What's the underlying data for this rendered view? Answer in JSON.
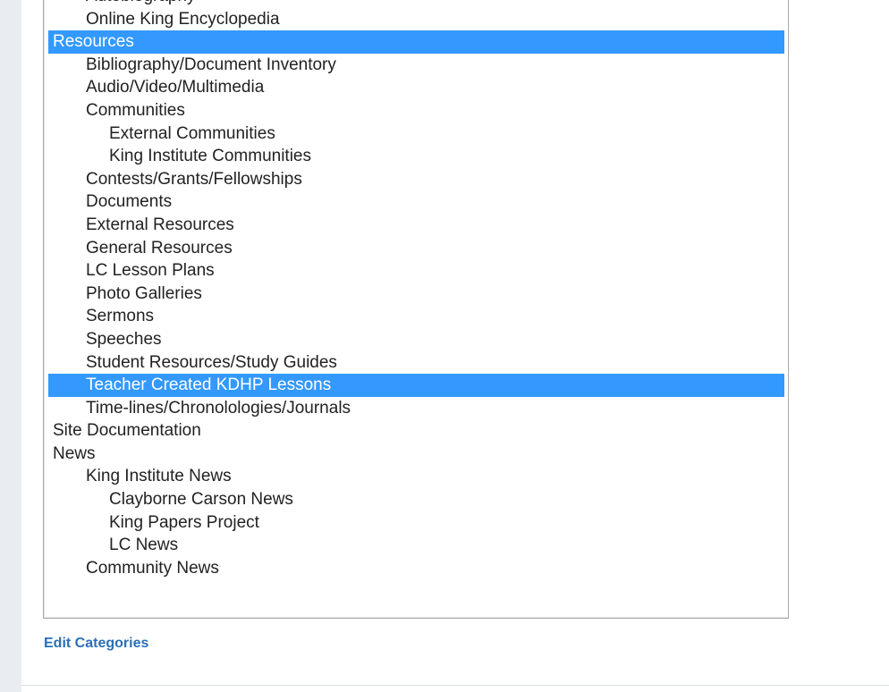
{
  "category_list": {
    "options": [
      {
        "label": "Autobiography",
        "level": 1,
        "selected": false
      },
      {
        "label": "Online King Encyclopedia",
        "level": 1,
        "selected": false
      },
      {
        "label": "Resources",
        "level": 0,
        "selected": true
      },
      {
        "label": "Bibliography/Document Inventory",
        "level": 1,
        "selected": false
      },
      {
        "label": "Audio/Video/Multimedia",
        "level": 1,
        "selected": false
      },
      {
        "label": "Communities",
        "level": 1,
        "selected": false
      },
      {
        "label": "External Communities",
        "level": 2,
        "selected": false
      },
      {
        "label": "King Institute Communities",
        "level": 2,
        "selected": false
      },
      {
        "label": "Contests/Grants/Fellowships",
        "level": 1,
        "selected": false
      },
      {
        "label": "Documents",
        "level": 1,
        "selected": false
      },
      {
        "label": "External Resources",
        "level": 1,
        "selected": false
      },
      {
        "label": "General Resources",
        "level": 1,
        "selected": false
      },
      {
        "label": "LC Lesson Plans",
        "level": 1,
        "selected": false
      },
      {
        "label": "Photo Galleries",
        "level": 1,
        "selected": false
      },
      {
        "label": "Sermons",
        "level": 1,
        "selected": false
      },
      {
        "label": "Speeches",
        "level": 1,
        "selected": false
      },
      {
        "label": "Student Resources/Study Guides",
        "level": 1,
        "selected": false
      },
      {
        "label": "Teacher Created KDHP Lessons",
        "level": 1,
        "selected": true
      },
      {
        "label": "Time-lines/Chronolologies/Journals",
        "level": 1,
        "selected": false
      },
      {
        "label": "Site Documentation",
        "level": 0,
        "selected": false
      },
      {
        "label": "News",
        "level": 0,
        "selected": false
      },
      {
        "label": "King Institute News",
        "level": 1,
        "selected": false
      },
      {
        "label": "Clayborne Carson News",
        "level": 2,
        "selected": false
      },
      {
        "label": "King Papers Project",
        "level": 2,
        "selected": false
      },
      {
        "label": "LC News",
        "level": 2,
        "selected": false
      },
      {
        "label": "Community News",
        "level": 1,
        "selected": false
      }
    ]
  },
  "edit_link": {
    "label": "Edit Categories"
  },
  "colors": {
    "selection": "#3399ff",
    "link": "#2b6fb6",
    "gutter": "#e9edf1"
  }
}
